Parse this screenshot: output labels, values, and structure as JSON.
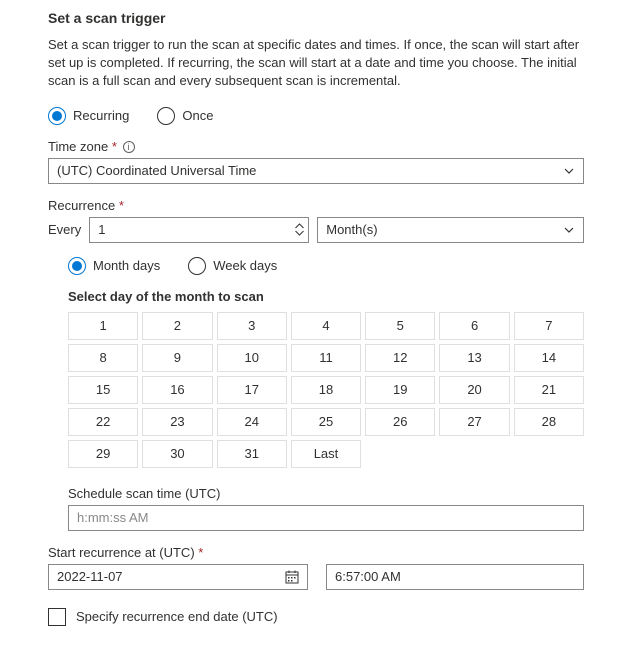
{
  "title": "Set a scan trigger",
  "description": "Set a scan trigger to run the scan at specific dates and times. If once, the scan will start after set up is completed. If recurring, the scan will start at a date and time you choose. The initial scan is a full scan and every subsequent scan is incremental.",
  "trigger_type": {
    "recurring_label": "Recurring",
    "once_label": "Once",
    "selected": "recurring"
  },
  "timezone": {
    "label": "Time zone",
    "value": "(UTC) Coordinated Universal Time"
  },
  "recurrence": {
    "label": "Recurrence",
    "every_label": "Every",
    "interval": "1",
    "unit": "Month(s)"
  },
  "day_type": {
    "month_label": "Month days",
    "week_label": "Week days",
    "selected": "month"
  },
  "day_picker": {
    "title": "Select day of the month to scan",
    "days": [
      "1",
      "2",
      "3",
      "4",
      "5",
      "6",
      "7",
      "8",
      "9",
      "10",
      "11",
      "12",
      "13",
      "14",
      "15",
      "16",
      "17",
      "18",
      "19",
      "20",
      "21",
      "22",
      "23",
      "24",
      "25",
      "26",
      "27",
      "28",
      "29",
      "30",
      "31",
      "Last"
    ]
  },
  "schedule_time": {
    "label": "Schedule scan time (UTC)",
    "placeholder": "h:mm:ss AM"
  },
  "start": {
    "label": "Start recurrence at (UTC)",
    "date": "2022-11-07",
    "time": "6:57:00 AM"
  },
  "end_checkbox": {
    "label": "Specify recurrence end date (UTC)",
    "checked": false
  },
  "required_mark": "*"
}
